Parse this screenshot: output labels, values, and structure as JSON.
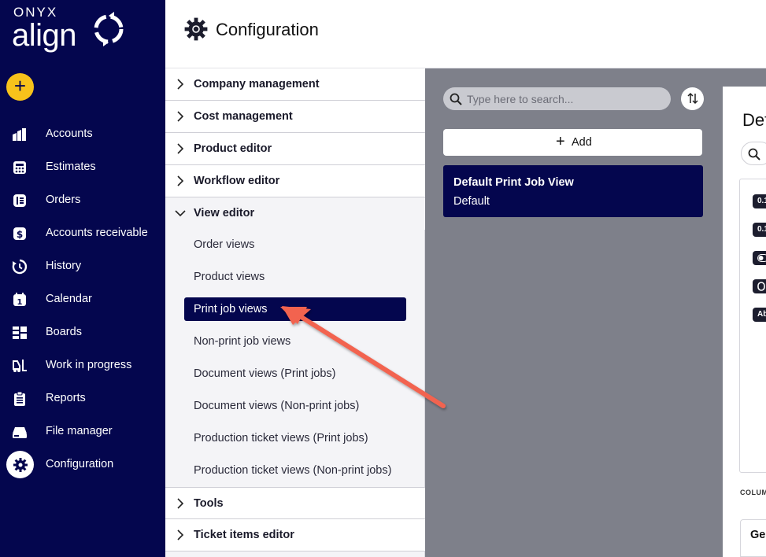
{
  "app": {
    "brand_top": "ONYX",
    "brand_main": "align"
  },
  "nav": {
    "items": [
      {
        "label": "Accounts",
        "icon": "accounts-icon"
      },
      {
        "label": "Estimates",
        "icon": "calculator-icon"
      },
      {
        "label": "Orders",
        "icon": "orders-icon"
      },
      {
        "label": "Accounts receivable",
        "icon": "dollar-icon"
      },
      {
        "label": "History",
        "icon": "history-icon"
      },
      {
        "label": "Calendar",
        "icon": "calendar-icon"
      },
      {
        "label": "Boards",
        "icon": "boards-icon"
      },
      {
        "label": "Work in progress",
        "icon": "forklift-icon"
      },
      {
        "label": "Reports",
        "icon": "clipboard-icon"
      },
      {
        "label": "File manager",
        "icon": "drive-icon"
      },
      {
        "label": "Configuration",
        "icon": "gear-icon"
      }
    ],
    "calendar_day": "1",
    "accent_color": "#04064e",
    "add_color": "#f7c21b"
  },
  "header": {
    "title": "Configuration"
  },
  "config": {
    "sections": [
      {
        "label": "Company management",
        "expanded": false
      },
      {
        "label": "Cost management",
        "expanded": false
      },
      {
        "label": "Product editor",
        "expanded": false
      },
      {
        "label": "Workflow editor",
        "expanded": false
      },
      {
        "label": "View editor",
        "expanded": true
      },
      {
        "label": "Tools",
        "expanded": false
      },
      {
        "label": "Ticket items editor",
        "expanded": false
      }
    ],
    "view_editor_items": [
      {
        "label": "Order views",
        "selected": false
      },
      {
        "label": "Product views",
        "selected": false
      },
      {
        "label": "Print job views",
        "selected": true
      },
      {
        "label": "Non-print job views",
        "selected": false
      },
      {
        "label": "Document views (Print jobs)",
        "selected": false
      },
      {
        "label": "Document views (Non-print jobs)",
        "selected": false
      },
      {
        "label": "Production ticket views (Print jobs)",
        "selected": false
      },
      {
        "label": "Production ticket views (Non-print jobs)",
        "selected": false
      }
    ]
  },
  "list": {
    "search_placeholder": "Type here to search...",
    "add_label": "Add",
    "views": [
      {
        "name": "Default Print Job View",
        "subtitle": "Default"
      }
    ]
  },
  "detail": {
    "title_partial": "Def",
    "chips": [
      "0.1",
      "0.1",
      "",
      "",
      "Ab"
    ],
    "column_header_partial": "COLUM",
    "group_partial": "Ger"
  },
  "annotation": {
    "arrow_color": "#f26350"
  }
}
